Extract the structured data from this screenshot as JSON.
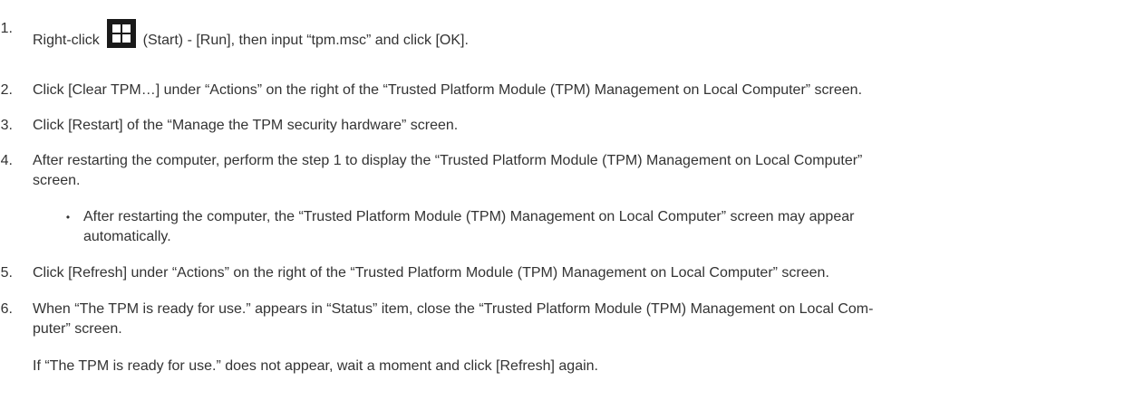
{
  "steps": [
    {
      "number": "1.",
      "text_before_icon": "Right-click ",
      "icon": "windows-start-icon",
      "text_after_icon": " (Start) - [Run], then input “tpm.msc” and click [OK]."
    },
    {
      "number": "2.",
      "text": "Click [Clear TPM…] under “Actions” on the right of the “Trusted Platform Module (TPM) Management on Local Computer” screen."
    },
    {
      "number": "3.",
      "text": "Click [Restart] of the “Manage the TPM security hardware” screen."
    },
    {
      "number": "4.",
      "text_line1": "After restarting the computer, perform the step 1 to display the “Trusted Platform Module (TPM) Management on Local Computer”",
      "text_line2": "screen.",
      "sub_bullet_symbol": "•",
      "sub_line1": "After restarting the computer, the “Trusted Platform Module (TPM) Management on Local Computer” screen may appear",
      "sub_line2": "automatically."
    },
    {
      "number": "5.",
      "text": "Click [Refresh] under “Actions” on the right of the “Trusted Platform Module (TPM) Management on Local Computer” screen."
    },
    {
      "number": "6.",
      "text_line1": "When “The TPM is ready for use.” appears in “Status” item, close the “Trusted Platform Module (TPM) Management on Local Com-",
      "text_line2": "puter” screen.",
      "note": "If “The TPM is ready for use.” does not appear, wait a moment and click [Refresh] again."
    }
  ],
  "colors": {
    "text": "#333333",
    "icon_background": "#1a1a1a",
    "icon_tiles": "#ffffff"
  }
}
